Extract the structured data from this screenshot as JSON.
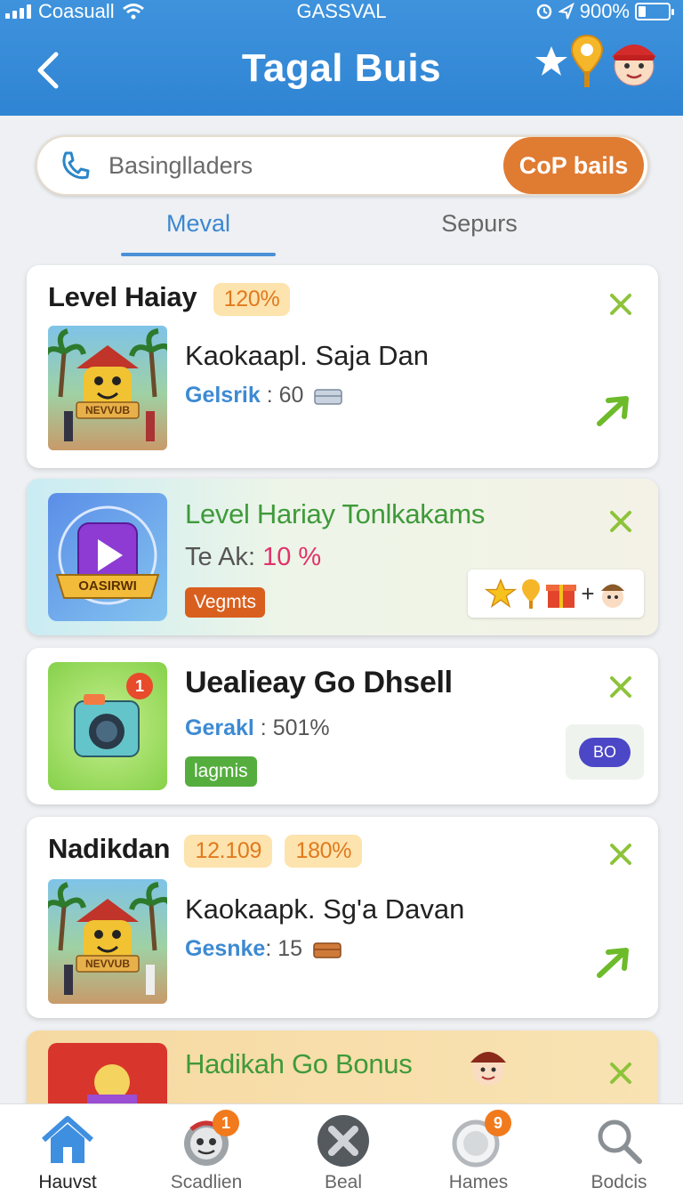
{
  "status_bar": {
    "carrier": "Coasuall",
    "center": "GASSVAL",
    "battery": "900%"
  },
  "header": {
    "title": "Tagal Buis"
  },
  "search": {
    "placeholder": "Basinglladers",
    "cta": "CoP bails"
  },
  "tabs": [
    {
      "label": "Meval",
      "active": true
    },
    {
      "label": "Sepurs",
      "active": false
    }
  ],
  "cards": [
    {
      "title": "Level Haiay",
      "pill": "120%",
      "thumb_label": "NEVVUB",
      "name": "Kaokaapl. Saja Dan",
      "meta_key": "Gelsrik",
      "meta_val": "60"
    },
    {
      "title": "Level Hariay Tonlkakams",
      "thumb_label": "OASIRWI",
      "meta_key": "Te Ak",
      "meta_val": "10 %",
      "chip": "Vegmts"
    },
    {
      "title": "Uealieay Go Dhsell",
      "thumb_badge": "1",
      "meta_key": "Gerakl",
      "meta_val": "501%",
      "chip": "lagmis",
      "side_button": "BO"
    },
    {
      "title": "Nadikdan",
      "pills": [
        "12.109",
        "180%"
      ],
      "thumb_label": "NEVVUB",
      "name": "Kaokaapk. Sg'a Davan",
      "meta_key": "Gesnke",
      "meta_val": "15"
    },
    {
      "title": "Hadikah Go Bonus"
    }
  ],
  "bottom_nav": [
    {
      "label": "Hauvst",
      "icon": "home-icon",
      "active": true
    },
    {
      "label": "Scadlien",
      "icon": "robot-icon",
      "badge": "1"
    },
    {
      "label": "Beal",
      "icon": "close-circle-icon"
    },
    {
      "label": "Hames",
      "icon": "ring-icon",
      "badge": "9"
    },
    {
      "label": "Bodcis",
      "icon": "search-icon"
    }
  ],
  "colors": {
    "header": "#2f84d3",
    "accent": "#e07b32",
    "green": "#3f9a3a",
    "blue": "#3d8ad3"
  }
}
